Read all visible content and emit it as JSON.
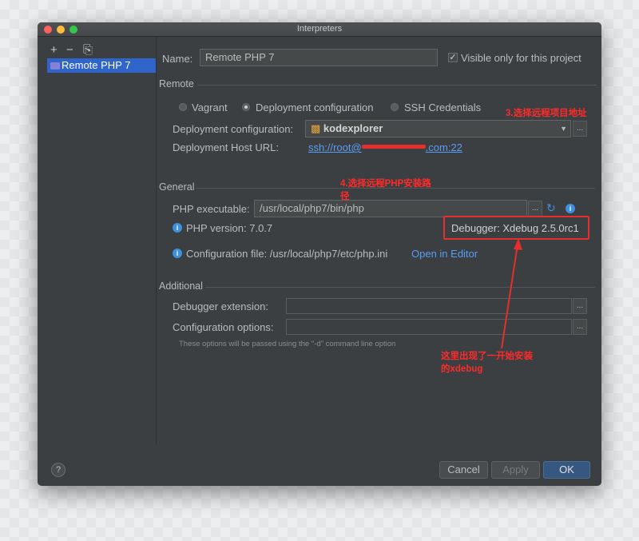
{
  "window": {
    "title": "Interpreters"
  },
  "sidebar": {
    "add_label": "+",
    "remove_label": "−",
    "copy_label": "⎘",
    "items": [
      {
        "label": "Remote PHP 7"
      }
    ]
  },
  "name": {
    "label": "Name:",
    "value": "Remote PHP 7"
  },
  "visible_only": {
    "label": "Visible only for this project",
    "checked": true
  },
  "remote": {
    "section": "Remote",
    "options": [
      {
        "label": "Vagrant",
        "selected": false
      },
      {
        "label": "Deployment configuration",
        "selected": true
      },
      {
        "label": "SSH Credentials",
        "selected": false
      }
    ],
    "deployment_configuration": {
      "label": "Deployment configuration:",
      "value": "kodexplorer",
      "dots": "..."
    },
    "host_url": {
      "label": "Deployment Host URL:",
      "value": "ssh://root@",
      "value_end": ".com:22"
    }
  },
  "general": {
    "section": "General",
    "php_executable": {
      "label": "PHP executable:",
      "value": "/usr/local/php7/bin/php",
      "dots": "..."
    },
    "php_version": "PHP version: 7.0.7",
    "debugger": "Debugger: Xdebug 2.5.0rc1",
    "config_file": "Configuration file: /usr/local/php7/etc/php.ini",
    "open_in_editor": "Open in Editor"
  },
  "additional": {
    "section": "Additional",
    "debugger_extension": {
      "label": "Debugger extension:",
      "value": "",
      "dots": "..."
    },
    "configuration_options": {
      "label": "Configuration options:",
      "value": "",
      "dots": "..."
    },
    "hint": "These options will be passed using the \"-d\" command line option"
  },
  "buttons": {
    "help": "?",
    "cancel": "Cancel",
    "apply": "Apply",
    "ok": "OK"
  },
  "annotations": {
    "step3": "3.选择远程项目地址",
    "step4_line1": "4.选择远程PHP安装路",
    "step4_line2": "径",
    "xdebug_line1": "这里出现了一开始安装",
    "xdebug_line2": "的xdebug"
  },
  "colors": {
    "annotation": "#e62e2e",
    "accent": "#2f65ca",
    "link": "#589df6",
    "info": "#3d8fdf"
  }
}
